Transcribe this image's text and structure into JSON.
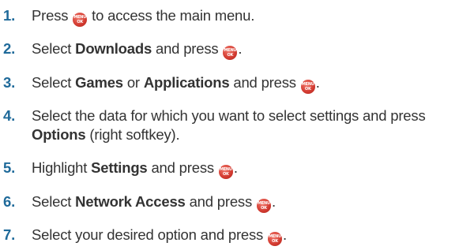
{
  "menu_key": {
    "line1": "MENU",
    "line2": "OK"
  },
  "steps": [
    {
      "number": "1.",
      "a": "Press ",
      "b": " to access the main menu."
    },
    {
      "number": "2.",
      "a": "Select ",
      "bold": "Downloads",
      "b": " and press ",
      "end": "."
    },
    {
      "number": "3.",
      "a": "Select ",
      "bold": "Games",
      "b": " or ",
      "bold2": "Applications",
      "c": " and press ",
      "end": "."
    },
    {
      "number": "4.",
      "a": "Select the data for which you want to select settings and press ",
      "bold": "Options",
      "b": " (right softkey)."
    },
    {
      "number": "5.",
      "a": "Highlight ",
      "bold": "Settings",
      "b": " and press ",
      "end": "."
    },
    {
      "number": "6.",
      "a": "Select ",
      "bold": "Network Access",
      "b": " and press ",
      "end": "."
    },
    {
      "number": "7.",
      "a": "Select your desired option and press ",
      "end": "."
    }
  ]
}
